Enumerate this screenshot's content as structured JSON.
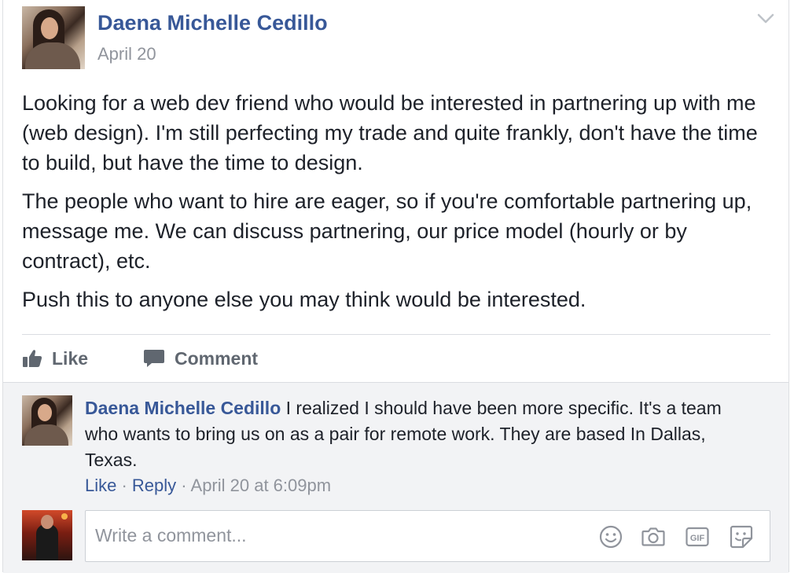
{
  "post": {
    "author": "Daena Michelle Cedillo",
    "date": "April 20",
    "paragraphs": [
      "Looking for a web dev friend who would be interested in partnering up with me (web design). I'm still perfecting my trade and quite frankly, don't have the time to build, but have the time to design.",
      "The people who want to hire are eager, so if you're comfortable partnering up, message me. We can discuss partnering, our price model (hourly or by contract), etc.",
      "Push this to anyone else you may think would be interested."
    ]
  },
  "actions": {
    "like_label": "Like",
    "comment_label": "Comment"
  },
  "comment": {
    "author": "Daena Michelle Cedillo",
    "text": " I realized I should have been more specific. It's a team who wants to bring us on as a pair for remote work. They are based In Dallas, Texas.",
    "like_label": "Like",
    "separator": " · ",
    "reply_label": "Reply",
    "timestamp": "April 20 at 6:09pm"
  },
  "composer": {
    "placeholder": "Write a comment...",
    "gif_label": "GIF"
  },
  "icons": {
    "chevron": "chevron-down-icon",
    "like": "thumbs-up-icon",
    "comment": "speech-bubble-icon",
    "emoji": "smiley-icon",
    "camera": "camera-icon",
    "gif": "gif-icon",
    "sticker": "sticker-icon"
  },
  "colors": {
    "link_blue": "#385898",
    "text": "#1d2129",
    "muted": "#90949c",
    "action_gray": "#606770",
    "comments_bg": "#f2f3f5"
  }
}
